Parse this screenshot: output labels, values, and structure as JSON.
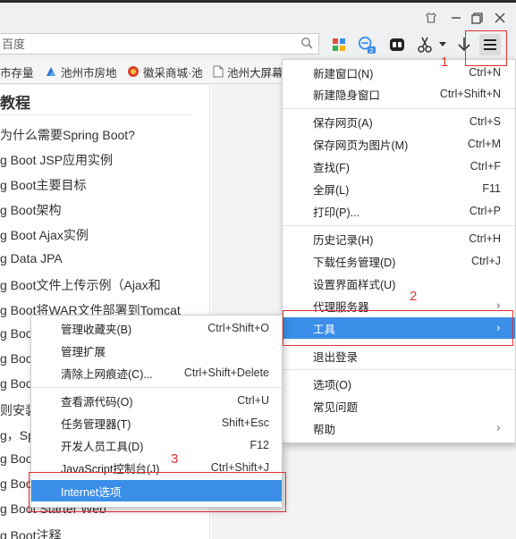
{
  "search": {
    "placeholder": "百度"
  },
  "bookmarks": [
    {
      "label": "市存量",
      "icon": "link-icon"
    },
    {
      "label": "池州市房地",
      "icon": "bookmark-icon"
    },
    {
      "label": "徽采商城·池",
      "icon": "shop-icon"
    },
    {
      "label": "池州大屏幕",
      "icon": "page-icon"
    }
  ],
  "sidebar": {
    "heading": "教程",
    "items": [
      "为什么需要Spring Boot?",
      "g Boot JSP应用实例",
      "g Boot主要目标",
      "g Boot架构",
      "g Boot Ajax实例",
      "g Data JPA",
      "g Boot文件上传示例（Ajax和",
      "g Boot将WAR文件部署到Tomcat",
      "g Boo",
      "g Boo",
      "g Boo",
      "则安装S",
      "g，Sp",
      "g Boo",
      "g Boo",
      "g Boot Starter Web",
      "g Boot注释"
    ]
  },
  "main_menu": {
    "items": [
      {
        "label": "新建窗口(N)",
        "shortcut": "Ctrl+N"
      },
      {
        "label": "新建隐身窗口",
        "shortcut": "Ctrl+Shift+N"
      },
      {
        "label": "保存网页(A)",
        "shortcut": "Ctrl+S"
      },
      {
        "label": "保存网页为图片(M)",
        "shortcut": "Ctrl+M"
      },
      {
        "label": "查找(F)",
        "shortcut": "Ctrl+F"
      },
      {
        "label": "全屏(L)",
        "shortcut": "F11"
      },
      {
        "label": "打印(P)...",
        "shortcut": "Ctrl+P"
      },
      {
        "label": "历史记录(H)",
        "shortcut": "Ctrl+H"
      },
      {
        "label": "下载任务管理(D)",
        "shortcut": "Ctrl+J"
      },
      {
        "label": "设置界面样式(U)",
        "shortcut": ""
      },
      {
        "label": "代理服务器",
        "shortcut": ""
      },
      {
        "label": "工具",
        "shortcut": ""
      },
      {
        "label": "退出登录",
        "shortcut": ""
      },
      {
        "label": "选项(O)",
        "shortcut": ""
      },
      {
        "label": "常见问题",
        "shortcut": ""
      },
      {
        "label": "帮助",
        "shortcut": ""
      }
    ]
  },
  "tools_submenu": {
    "items": [
      {
        "label": "管理收藏夹(B)",
        "shortcut": "Ctrl+Shift+O"
      },
      {
        "label": "管理扩展",
        "shortcut": ""
      },
      {
        "label": "清除上网痕迹(C)...",
        "shortcut": "Ctrl+Shift+Delete"
      },
      {
        "label": "查看源代码(O)",
        "shortcut": "Ctrl+U"
      },
      {
        "label": "任务管理器(T)",
        "shortcut": "Shift+Esc"
      },
      {
        "label": "开发人员工具(D)",
        "shortcut": "F12"
      },
      {
        "label": "JavaScript控制台(J)",
        "shortcut": "Ctrl+Shift+J"
      },
      {
        "label": "Internet选项",
        "shortcut": ""
      }
    ]
  },
  "annotations": {
    "step1": "1",
    "step2": "2",
    "step3": "3"
  },
  "toolbar": {
    "badge_count": "2"
  },
  "colors": {
    "highlight": "#3b8fe8",
    "annotation": "#e03030"
  }
}
